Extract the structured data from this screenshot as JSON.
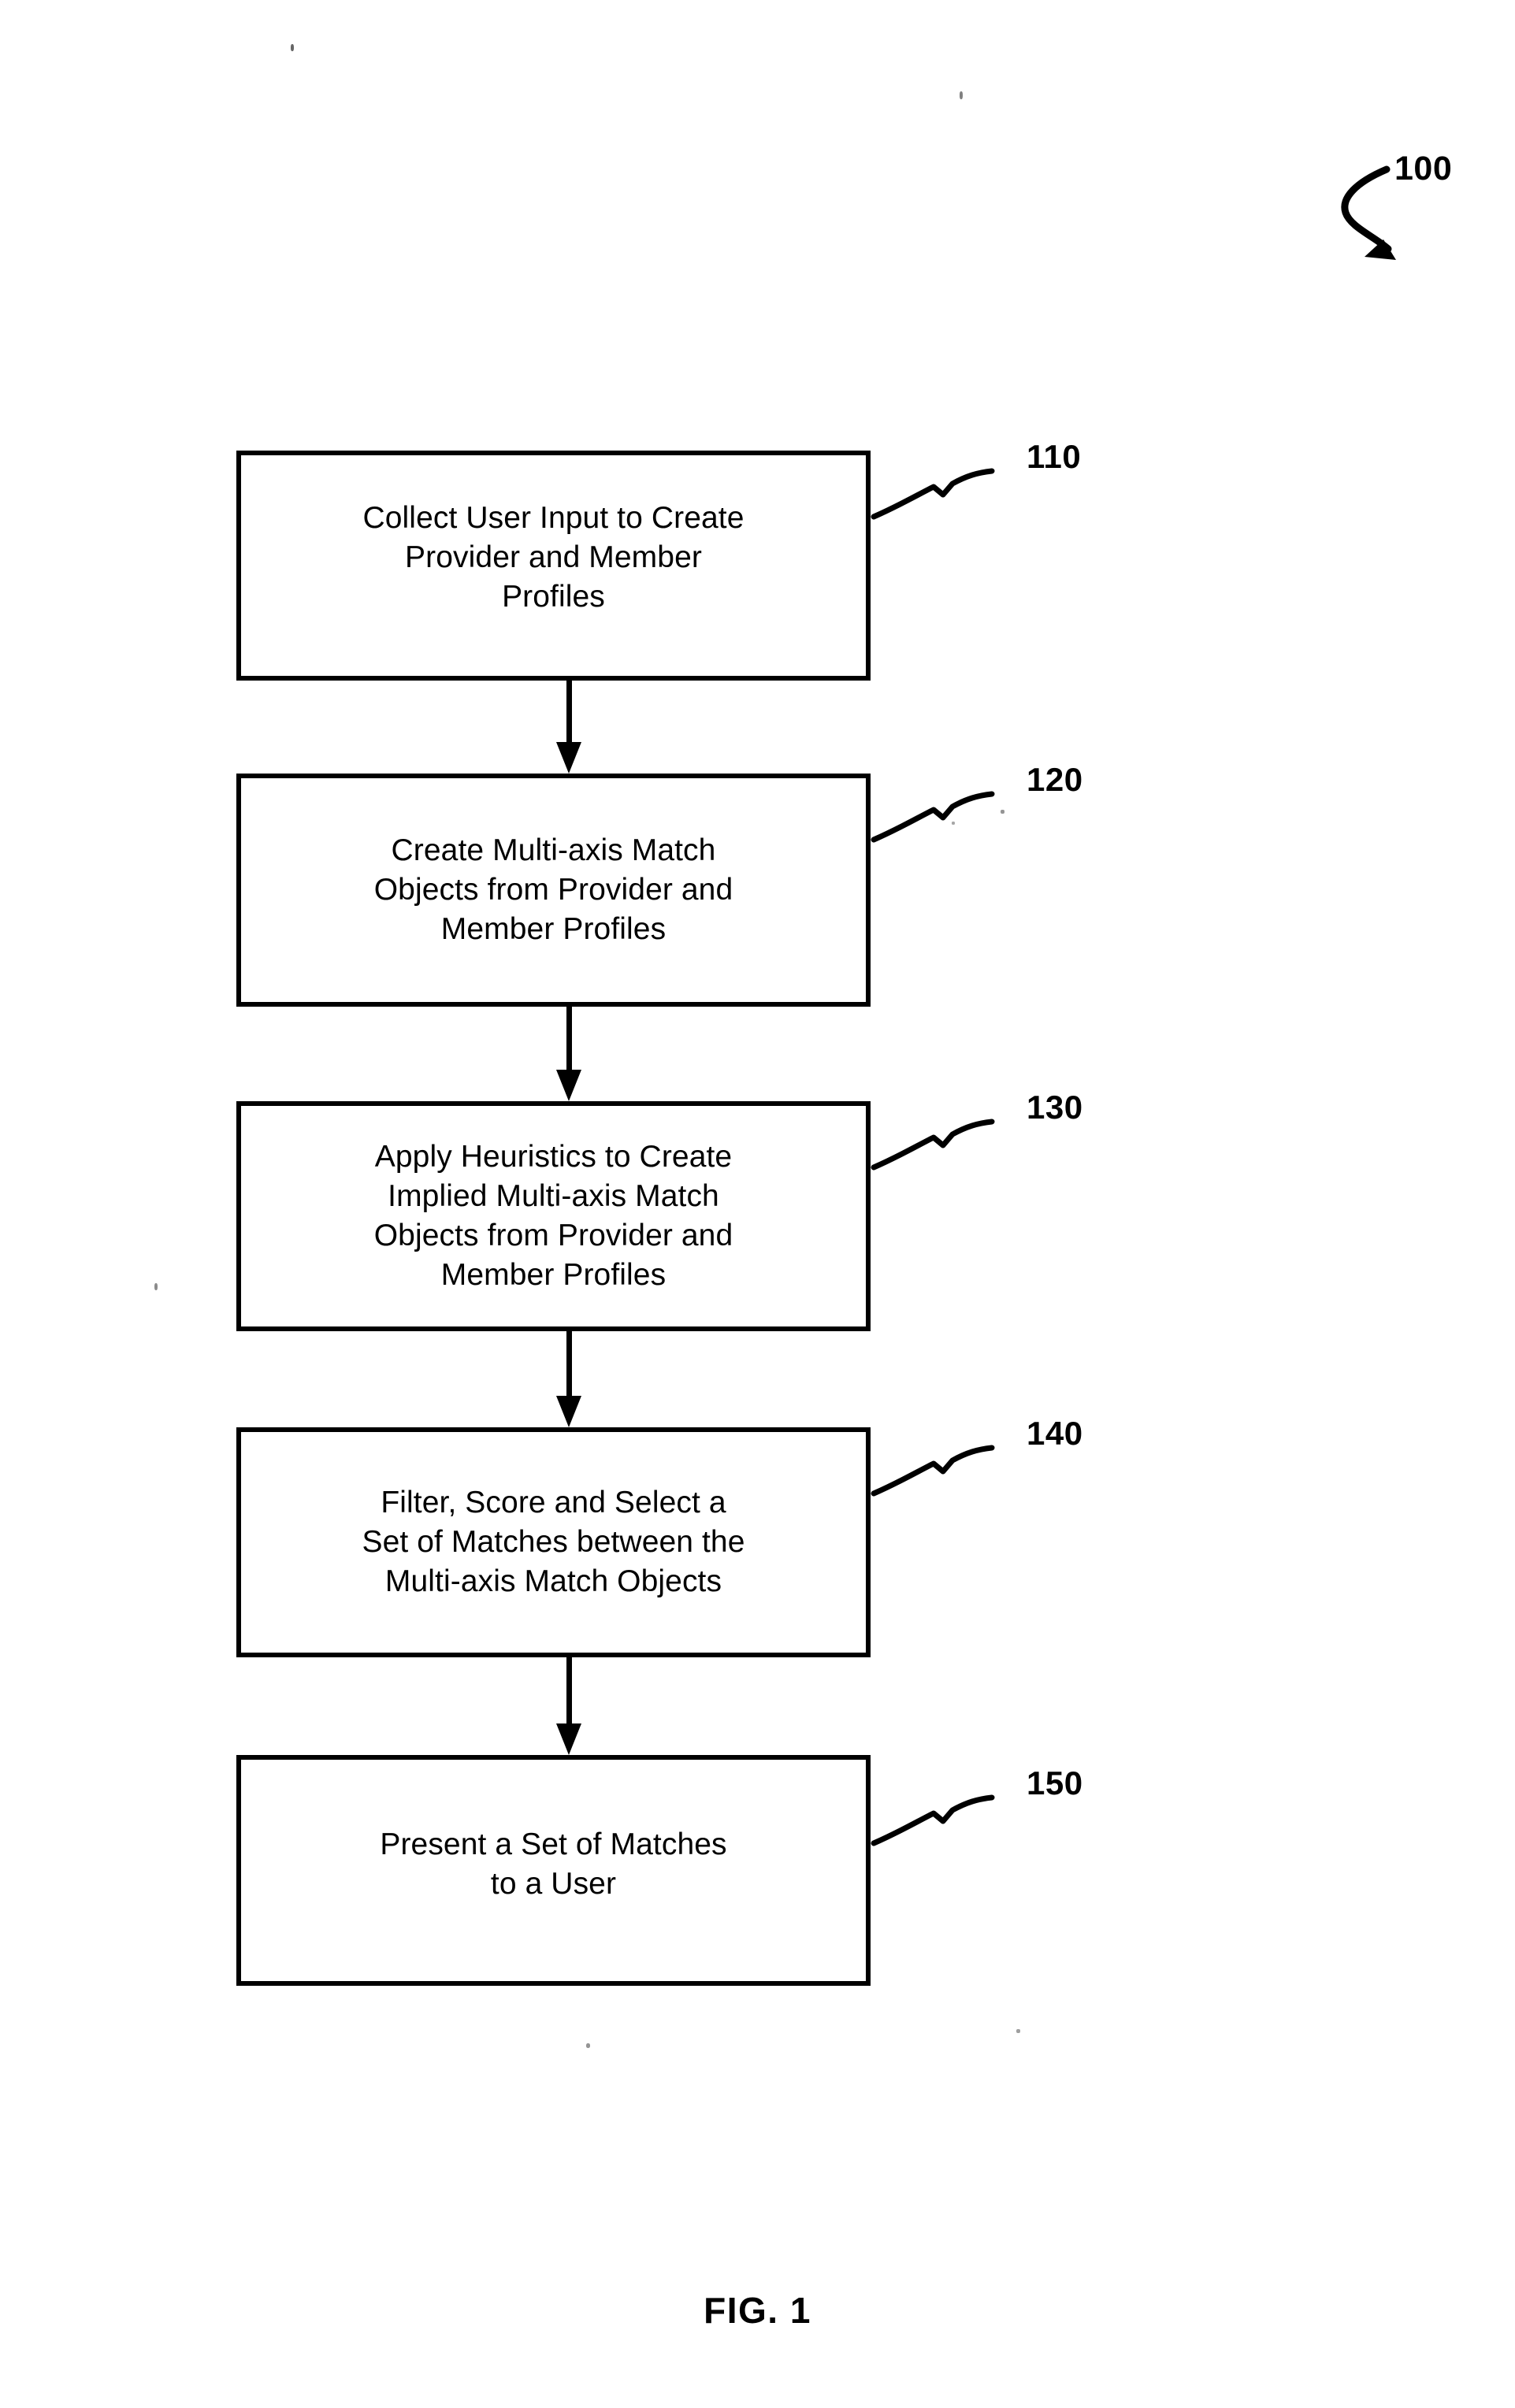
{
  "figure": {
    "caption": "FIG. 1",
    "overall_reference": "100"
  },
  "flowchart": {
    "type": "flowchart",
    "orientation": "vertical-top-to-bottom",
    "steps": [
      {
        "ref": "110",
        "label": "Collect User Input to Create\nProvider and Member\nProfiles"
      },
      {
        "ref": "120",
        "label": "Create Multi-axis Match\nObjects from Provider and\nMember Profiles"
      },
      {
        "ref": "130",
        "label": "Apply Heuristics to Create\nImplied Multi-axis Match\nObjects from Provider and\nMember Profiles"
      },
      {
        "ref": "140",
        "label": "Filter, Score and Select a\nSet of Matches between the\nMulti-axis Match Objects"
      },
      {
        "ref": "150",
        "label": "Present a Set of Matches\nto a User"
      }
    ],
    "connectors": [
      {
        "from": "110",
        "to": "120",
        "arrow": "down-arrow-icon"
      },
      {
        "from": "120",
        "to": "130",
        "arrow": "down-arrow-icon"
      },
      {
        "from": "130",
        "to": "140",
        "arrow": "down-arrow-icon"
      },
      {
        "from": "140",
        "to": "150",
        "arrow": "down-arrow-icon"
      }
    ]
  },
  "colors": {
    "ink": "#000000",
    "paper": "#ffffff"
  }
}
